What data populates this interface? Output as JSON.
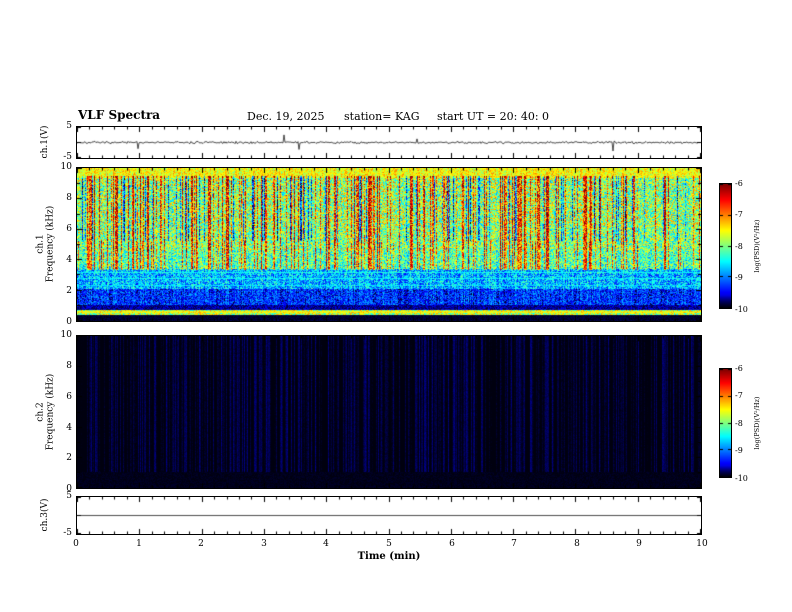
{
  "title": {
    "main": "VLF Spectra",
    "date": "Dec. 19, 2025",
    "station": "station= KAG",
    "start_ut": "start UT =  20: 40: 0"
  },
  "left_labels": {
    "ch1_wave": "ch.1(V)",
    "ch1_spec": "ch.1",
    "ch2_spec": "ch.2",
    "freq_axis": "Frequency (kHz)",
    "ch3_wave": "ch.3(V)"
  },
  "yaxis": {
    "wave_max": "5",
    "wave_min": "-5",
    "spec_yticks": [
      "10",
      "8",
      "6",
      "4",
      "2",
      "0"
    ]
  },
  "xaxis": {
    "label": "Time (min)",
    "ticks": [
      "0",
      "1",
      "2",
      "3",
      "4",
      "5",
      "6",
      "7",
      "8",
      "9",
      "10"
    ]
  },
  "colorbar": {
    "label": "log(PSD)(V²/Hz)",
    "ticks": [
      "-6",
      "-7",
      "-8",
      "-9",
      "-10"
    ]
  },
  "chart_data": [
    {
      "id": "ch1_waveform",
      "type": "line",
      "title": "ch.1(V) time series",
      "xlabel": "Time (min)",
      "xlim": [
        0,
        10
      ],
      "ylabel": "ch.1(V)",
      "ylim": [
        -5,
        5
      ],
      "yticks": [
        5,
        -5
      ],
      "description": "broadband noise trace centered on 0 V, ~±0.5 V fuzz with sporadic impulses to about ±2.5 V",
      "noise_amp": 0.35,
      "spike_prob": 0.008,
      "spike_amp": 2.2,
      "seed": 7
    },
    {
      "id": "ch1_spectrogram",
      "type": "heatmap",
      "title": "ch.1 VLF spectrogram",
      "xlim": [
        0,
        10
      ],
      "ylim": [
        0,
        10
      ],
      "ylabel": "ch.1 Frequency (kHz)",
      "yticks": [
        0,
        2,
        4,
        6,
        8,
        10
      ],
      "zlabel": "log(PSD)(V²/Hz)",
      "zlim": [
        -10,
        -6
      ],
      "colormap": "jet",
      "seed": 13,
      "description": "dense vertical red/orange streaks over green-yellow background from ~3.5-9.5 kHz, yellow-green band at 9.4-10 kHz, blue/cyan speckle 1-3.4 kHz, bright cyan-green band near 0.4-0.7 kHz, black below 0.4 kHz",
      "bands": [
        {
          "f0": 0.0,
          "f1": 0.38,
          "v": 0.02,
          "noise": 0.02
        },
        {
          "f0": 0.38,
          "f1": 0.72,
          "v": 0.55,
          "noise": 0.18
        },
        {
          "f0": 0.72,
          "f1": 1.05,
          "v": 0.07,
          "noise": 0.05
        },
        {
          "f0": 1.05,
          "f1": 2.1,
          "v": 0.17,
          "noise": 0.12
        },
        {
          "f0": 2.1,
          "f1": 3.4,
          "v": 0.3,
          "noise": 0.15
        },
        {
          "f0": 3.4,
          "f1": 4.6,
          "v": 0.45,
          "noise": 0.18
        },
        {
          "f0": 4.6,
          "f1": 6.2,
          "v": 0.5,
          "noise": 0.2
        },
        {
          "f0": 6.2,
          "f1": 9.4,
          "v": 0.52,
          "noise": 0.22
        },
        {
          "f0": 9.4,
          "f1": 10.0,
          "v": 0.62,
          "noise": 0.1
        }
      ],
      "hlines": [
        {
          "f": 0.55,
          "v": 0.6,
          "hw": 0.08
        },
        {
          "f": 2.3,
          "v": 0.34,
          "hw": 0.05
        },
        {
          "f": 2.75,
          "v": 0.36,
          "hw": 0.05
        },
        {
          "f": 3.15,
          "v": 0.38,
          "hw": 0.05
        }
      ],
      "streaks": {
        "f0": 3.3,
        "f1": 9.5,
        "prob": 0.3,
        "boost": 0.42,
        "gap_prob": 0.14,
        "gap_drop": 0.38
      }
    },
    {
      "id": "ch2_spectrogram",
      "type": "heatmap",
      "title": "ch.2 VLF spectrogram",
      "xlim": [
        0,
        10
      ],
      "ylim": [
        0,
        10
      ],
      "ylabel": "ch.2 Frequency (kHz)",
      "yticks": [
        0,
        2,
        4,
        6,
        8,
        10
      ],
      "zlabel": "log(PSD)(V²/Hz)",
      "zlim": [
        -10,
        -6
      ],
      "colormap": "jet",
      "seed": 29,
      "description": "power at the noise floor (~-10) across the whole band; panel renders essentially black with faint dark-blue speckle",
      "bands": [
        {
          "f0": 0.0,
          "f1": 10.0,
          "v": 0.008,
          "noise": 0.012
        }
      ],
      "hlines": [],
      "streaks": null
    },
    {
      "id": "ch3_waveform",
      "type": "line",
      "title": "ch.3(V) time series",
      "xlabel": "Time (min)",
      "xlim": [
        0,
        10
      ],
      "ylabel": "ch.3(V)",
      "ylim": [
        -5,
        5
      ],
      "yticks": [
        5,
        -5
      ],
      "description": "flat trace constant at 0 V",
      "noise_amp": 0.0,
      "spike_prob": 0.0,
      "spike_amp": 0.0,
      "seed": 3
    }
  ]
}
